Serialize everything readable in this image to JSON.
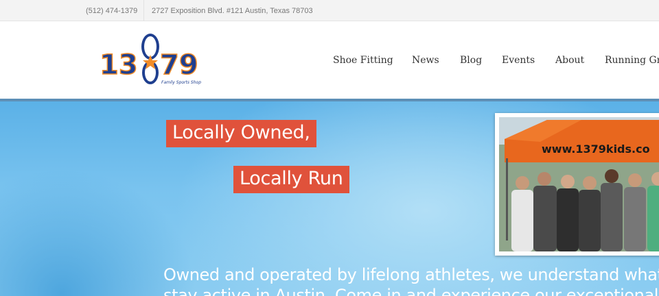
{
  "topbar": {
    "phone": "(512) 474-1379",
    "address": "2727 Exposition Blvd. #121 Austin, Texas 78703"
  },
  "logo": {
    "left_digits": "13",
    "right_digits": "79",
    "tagline": "Family Sports Shop",
    "icon": "footprint-star-icon"
  },
  "nav": {
    "items": [
      {
        "label": "Shoe Fitting"
      },
      {
        "label": "News"
      },
      {
        "label": "Blog"
      },
      {
        "label": "Events"
      },
      {
        "label": "About"
      },
      {
        "label": "Running Gro"
      }
    ]
  },
  "hero": {
    "tag1": "Locally Owned,",
    "tag2": "Locally Run",
    "tent_text": "www.1379kids.co",
    "body_line1": "Owned and operated by lifelong athletes, we understand what your f",
    "body_line2": "stay active in Austin. Come in and experience our exceptional custom"
  },
  "colors": {
    "accent_red": "#e0523b",
    "logo_blue": "#1f3f8f",
    "logo_orange": "#f28c28",
    "hero_blue": "#79c3ef"
  }
}
